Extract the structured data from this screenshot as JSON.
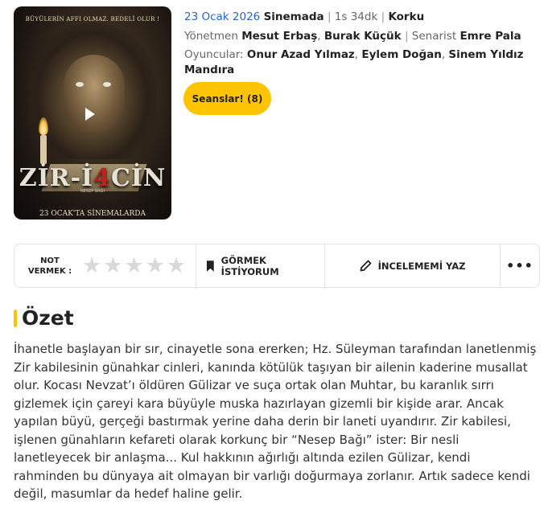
{
  "poster": {
    "tagline": "BÜYÜLERİN AFFI OLMAZ. BEDELİ OLUR !",
    "title_part1": "ZİR-İ",
    "title_part2": "4",
    "title_part3": "CİN",
    "subtitle": "NESEP BAĞI",
    "release": "23 OCAK'TA SİNEMALARDA"
  },
  "info": {
    "date": "23 Ocak 2026",
    "status": "Sinemada",
    "duration": "1s 34dk",
    "genre": "Korku",
    "director_label": "Yönetmen",
    "directors": [
      "Mesut Erbaş",
      "Burak Küçük"
    ],
    "writer_label": "Senarist",
    "writer": "Emre Pala",
    "cast_label": "Oyuncular:",
    "cast": [
      "Onur Azad Yılmaz",
      "Eylem Doğan",
      "Sinem Yıldız Mandıra"
    ],
    "sessions_button": "Seanslar! (8)"
  },
  "actions": {
    "rate_label": "NOT VERMEK :",
    "star_count": 5,
    "rating_value": 0,
    "watchlist_label": "GÖRMEK İSTİYORUM",
    "review_label": "İNCELEMEMİ YAZ",
    "more_label": "•••"
  },
  "summary": {
    "heading": "Özet",
    "text": "İhanetle başlayan bir sır, cinayetle sona ererken; Hz. Süleyman tarafından lanetlenmiş Zir kabilesinin günahkar cinleri, kanında kötülük taşıyan bir ailenin kaderine musallat olur. Kocası Nevzat’ı öldüren Gülizar ve suça ortak olan Muhtar, bu karanlık sırrı gizlemek için çareyi kara büyüyle muska hazırlayan gizemli bir kişide arar. Ancak yapılan büyü, gerçeği bastırmak yerine daha derin bir laneti uyandırır. Zir kabilesi, işlenen günahların kefareti olarak korkunç bir “Nesep Bağı” ister: Bir nesli lanetleyecek bir anlaşma... Kul hakkının ağırlığı altında ezilen Gülizar, kendi rahminden bu dünyaya ait olmayan bir varlığı doğurmaya zorlanır. Artık sadece kendi değil, masumlar da hedef haline gelir."
  },
  "colors": {
    "accent": "#ffc400",
    "date": "#2b64c5",
    "star_empty": "#d9d9d9"
  }
}
